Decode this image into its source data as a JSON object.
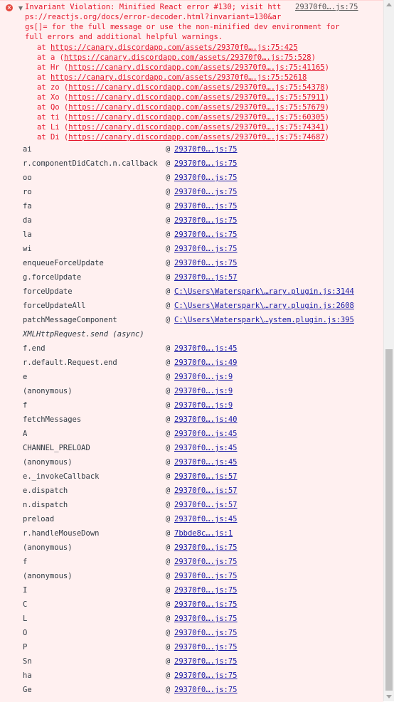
{
  "error": {
    "message_lines": [
      "Invariant Violation: Minified React error #130; visit htt",
      "ps://reactjs.org/docs/error-decoder.html?invariant=130&ar",
      "gs[]= for the full message or use the non-minified dev env",
      "full errors and additional helpful warnings."
    ],
    "message_line3_full": "gs[]= for the full message or use the non-minified dev environment for",
    "source_link": "29370f0….js:75",
    "icon": "x-circle-icon"
  },
  "trace_lines": [
    {
      "prefix": "at ",
      "url": "https://canary.discordapp.com/assets/29370f0….js:75:425",
      "suffix": ""
    },
    {
      "prefix": "at a (",
      "url": "https://canary.discordapp.com/assets/29370f0….js:75:528",
      "suffix": ")"
    },
    {
      "prefix": "at Hr (",
      "url": "https://canary.discordapp.com/assets/29370f0….js:75:41165",
      "suffix": ")"
    },
    {
      "prefix": "at ",
      "url": "https://canary.discordapp.com/assets/29370f0….js:75:52618",
      "suffix": ""
    },
    {
      "prefix": "at zo (",
      "url": "https://canary.discordapp.com/assets/29370f0….js:75:54378",
      "suffix": ")"
    },
    {
      "prefix": "at Xo (",
      "url": "https://canary.discordapp.com/assets/29370f0….js:75:57911",
      "suffix": ")"
    },
    {
      "prefix": "at Qo (",
      "url": "https://canary.discordapp.com/assets/29370f0….js:75:57679",
      "suffix": ")"
    },
    {
      "prefix": "at ti (",
      "url": "https://canary.discordapp.com/assets/29370f0….js:75:60305",
      "suffix": ")"
    },
    {
      "prefix": "at Li (",
      "url": "https://canary.discordapp.com/assets/29370f0….js:75:74341",
      "suffix": ")"
    },
    {
      "prefix": "at Di (",
      "url": "https://canary.discordapp.com/assets/29370f0….js:75:74687",
      "suffix": ")"
    }
  ],
  "at_symbol": "@",
  "frames": [
    {
      "fn": "ai",
      "loc": "29370f0….js:75"
    },
    {
      "fn": "r.componentDidCatch.n.callback",
      "loc": "29370f0….js:75"
    },
    {
      "fn": "oo",
      "loc": "29370f0….js:75"
    },
    {
      "fn": "ro",
      "loc": "29370f0….js:75"
    },
    {
      "fn": "fa",
      "loc": "29370f0….js:75"
    },
    {
      "fn": "da",
      "loc": "29370f0….js:75"
    },
    {
      "fn": "la",
      "loc": "29370f0….js:75"
    },
    {
      "fn": "wi",
      "loc": "29370f0….js:75"
    },
    {
      "fn": "enqueueForceUpdate",
      "loc": "29370f0….js:75"
    },
    {
      "fn": "g.forceUpdate",
      "loc": "29370f0….js:57"
    },
    {
      "fn": "forceUpdate",
      "loc": "C:\\Users\\Waterspark\\…rary.plugin.js:3144"
    },
    {
      "fn": "forceUpdateAll",
      "loc": "C:\\Users\\Waterspark\\…rary.plugin.js:2608"
    },
    {
      "fn": "patchMessageComponent",
      "loc": "C:\\Users\\Waterspark\\…ystem.plugin.js:395"
    },
    {
      "fn": "XMLHttpRequest.send (async)",
      "loc": "",
      "async": true
    },
    {
      "fn": "f.end",
      "loc": "29370f0….js:45"
    },
    {
      "fn": "r.default.Request.end",
      "loc": "29370f0….js:49"
    },
    {
      "fn": "e",
      "loc": "29370f0….js:9"
    },
    {
      "fn": "(anonymous)",
      "loc": "29370f0….js:9"
    },
    {
      "fn": "f",
      "loc": "29370f0….js:9"
    },
    {
      "fn": "fetchMessages",
      "loc": "29370f0….js:40"
    },
    {
      "fn": "A",
      "loc": "29370f0….js:45"
    },
    {
      "fn": "CHANNEL_PRELOAD",
      "loc": "29370f0….js:45"
    },
    {
      "fn": "(anonymous)",
      "loc": "29370f0….js:45"
    },
    {
      "fn": "e._invokeCallback",
      "loc": "29370f0….js:57"
    },
    {
      "fn": "e.dispatch",
      "loc": "29370f0….js:57"
    },
    {
      "fn": "n.dispatch",
      "loc": "29370f0….js:57"
    },
    {
      "fn": "preload",
      "loc": "29370f0….js:45"
    },
    {
      "fn": "r.handleMouseDown",
      "loc": "7bbde8c….js:1"
    },
    {
      "fn": "(anonymous)",
      "loc": "29370f0….js:75"
    },
    {
      "fn": "f",
      "loc": "29370f0….js:75"
    },
    {
      "fn": "(anonymous)",
      "loc": "29370f0….js:75"
    },
    {
      "fn": "I",
      "loc": "29370f0….js:75"
    },
    {
      "fn": "C",
      "loc": "29370f0….js:75"
    },
    {
      "fn": "L",
      "loc": "29370f0….js:75"
    },
    {
      "fn": "O",
      "loc": "29370f0….js:75"
    },
    {
      "fn": "P",
      "loc": "29370f0….js:75"
    },
    {
      "fn": "Sn",
      "loc": "29370f0….js:75"
    },
    {
      "fn": "ha",
      "loc": "29370f0….js:75"
    },
    {
      "fn": "Ge",
      "loc": "29370f0….js:75"
    }
  ],
  "colors": {
    "error_text": "#e5172c",
    "error_bg": "#fff0f0",
    "link": "#1a1aa6",
    "function_text": "#303942"
  }
}
